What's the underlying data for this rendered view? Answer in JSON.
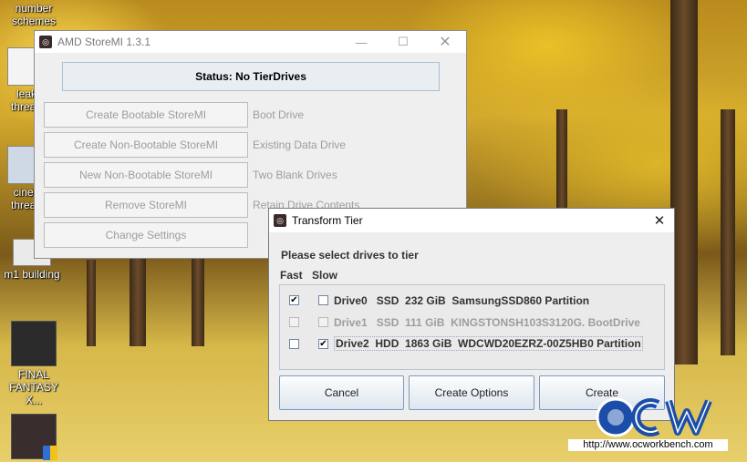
{
  "desktop": {
    "icons": [
      {
        "label": "number\nschemes"
      },
      {
        "label": "leak\nthread"
      },
      {
        "label": "cineb\nthread"
      },
      {
        "label": "m1 building"
      },
      {
        "label": "FINAL\nFANTASY X..."
      },
      {
        "label": ""
      }
    ]
  },
  "main_window": {
    "title": "AMD StoreMI 1.3.1",
    "status": "Status: No TierDrives",
    "actions": [
      {
        "button": "Create Bootable StoreMI",
        "description": "Boot Drive"
      },
      {
        "button": "Create Non-Bootable StoreMI",
        "description": "Existing Data Drive"
      },
      {
        "button": "New Non-Bootable StoreMI",
        "description": "Two Blank Drives"
      },
      {
        "button": "Remove StoreMI",
        "description": "Retain Drive Contents"
      },
      {
        "button": "Change Settings",
        "description": ""
      }
    ]
  },
  "dialog": {
    "title": "Transform Tier",
    "prompt": "Please select drives to tier",
    "col_fast": "Fast",
    "col_slow": "Slow",
    "drives": [
      {
        "label": "Drive0   SSD  232 GiB  SamsungSSD860 Partition",
        "fast": true,
        "slow": false,
        "enabled": true
      },
      {
        "label": "Drive1   SSD  111 GiB  KINGSTONSH103S3120G. BootDrive",
        "fast": false,
        "slow": false,
        "enabled": false
      },
      {
        "label": "Drive2  HDD  1863 GiB  WDCWD20EZRZ-00Z5HB0 Partition",
        "fast": false,
        "slow": true,
        "enabled": true
      }
    ],
    "buttons": {
      "cancel": "Cancel",
      "options": "Create Options",
      "create": "Create"
    }
  },
  "watermark": {
    "logo": "OCW",
    "url": "http://www.ocworkbench.com"
  },
  "colors": {
    "accent": "#7a9abf",
    "watermark_blue": "#1b4ea8"
  }
}
